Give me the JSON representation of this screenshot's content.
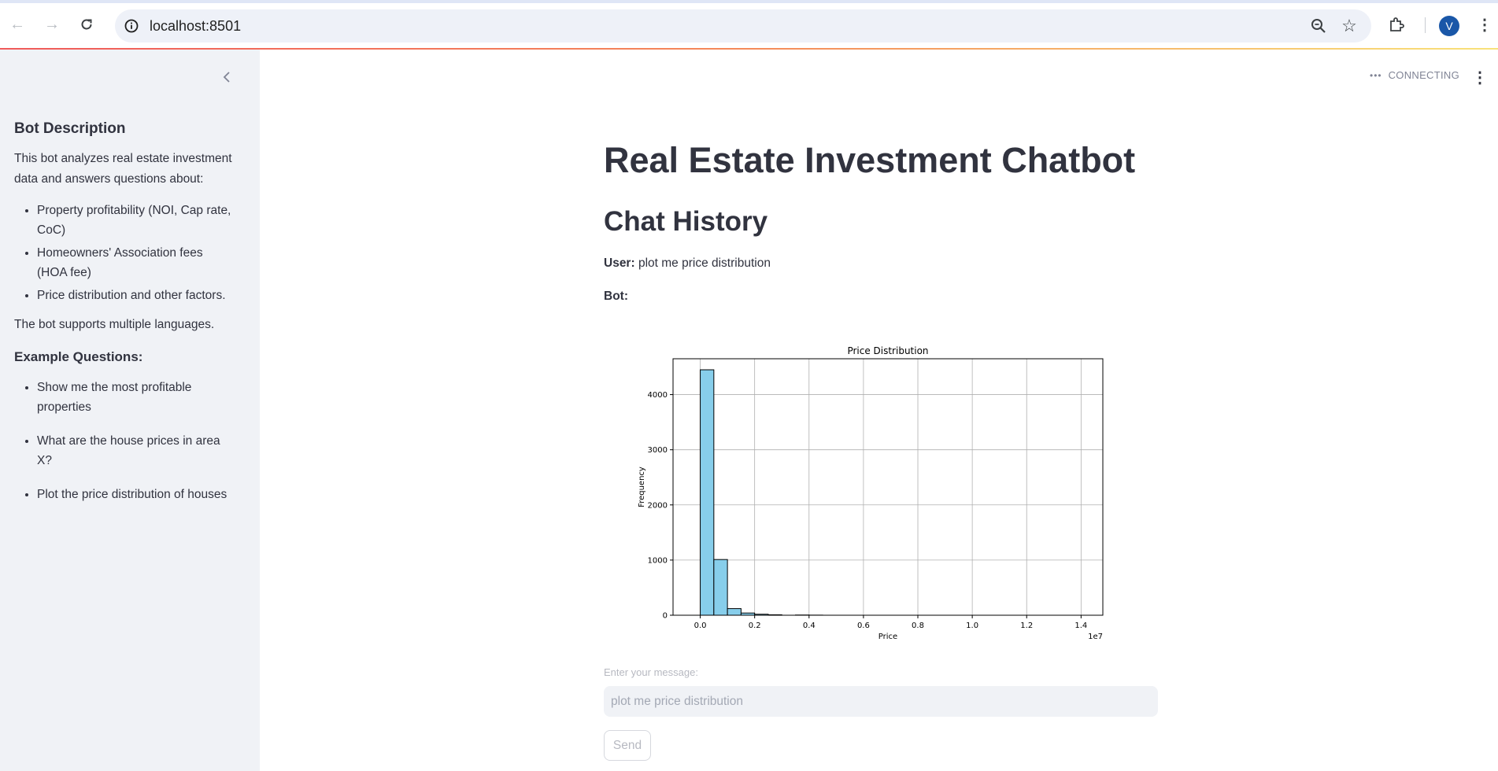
{
  "browser": {
    "url": "localhost:8501",
    "avatar_letter": "V",
    "icons": [
      "back-icon",
      "forward-icon",
      "reload-icon",
      "info-icon",
      "zoom-icon",
      "star-icon",
      "extensions-icon",
      "kebab-menu-icon"
    ]
  },
  "sidebar": {
    "heading": "Bot Description",
    "description": "This bot analyzes real estate investment data and answers questions about:",
    "topics": [
      "Property profitability (NOI, Cap rate, CoC)",
      "Homeowners' Association fees (HOA fee)",
      "Price distribution and other factors."
    ],
    "languages_note": "The bot supports multiple languages.",
    "examples_heading": "Example Questions:",
    "examples": [
      "Show me the most profitable properties",
      "What are the house prices in area X?",
      "Plot the price distribution of houses"
    ]
  },
  "status": {
    "text": "CONNECTING"
  },
  "main": {
    "title": "Real Estate Investment Chatbot",
    "history_heading": "Chat History",
    "messages": [
      {
        "role": "User:",
        "text": "plot me price distribution"
      },
      {
        "role": "Bot:",
        "text": ""
      }
    ],
    "input_label": "Enter your message:",
    "input_value": "plot me price distribution",
    "send_label": "Send"
  },
  "chart_data": {
    "type": "bar",
    "title": "Price Distribution",
    "xlabel": "Price",
    "ylabel": "Frequency",
    "x_offset_label": "1e7",
    "bin_width": 500000,
    "bin_starts": [
      0,
      500000,
      1000000,
      1500000,
      2000000,
      2500000,
      3500000,
      4000000
    ],
    "values": [
      4450,
      1010,
      120,
      40,
      18,
      8,
      4,
      2
    ],
    "xlim": [
      -0.1,
      1.48
    ],
    "ylim": [
      0,
      4650
    ],
    "xticks": [
      "0.0",
      "0.2",
      "0.4",
      "0.6",
      "0.8",
      "1.0",
      "1.2",
      "1.4"
    ],
    "yticks": [
      "0",
      "1000",
      "2000",
      "3000",
      "4000"
    ],
    "grid": true,
    "bar_color": "#87ceeb"
  }
}
